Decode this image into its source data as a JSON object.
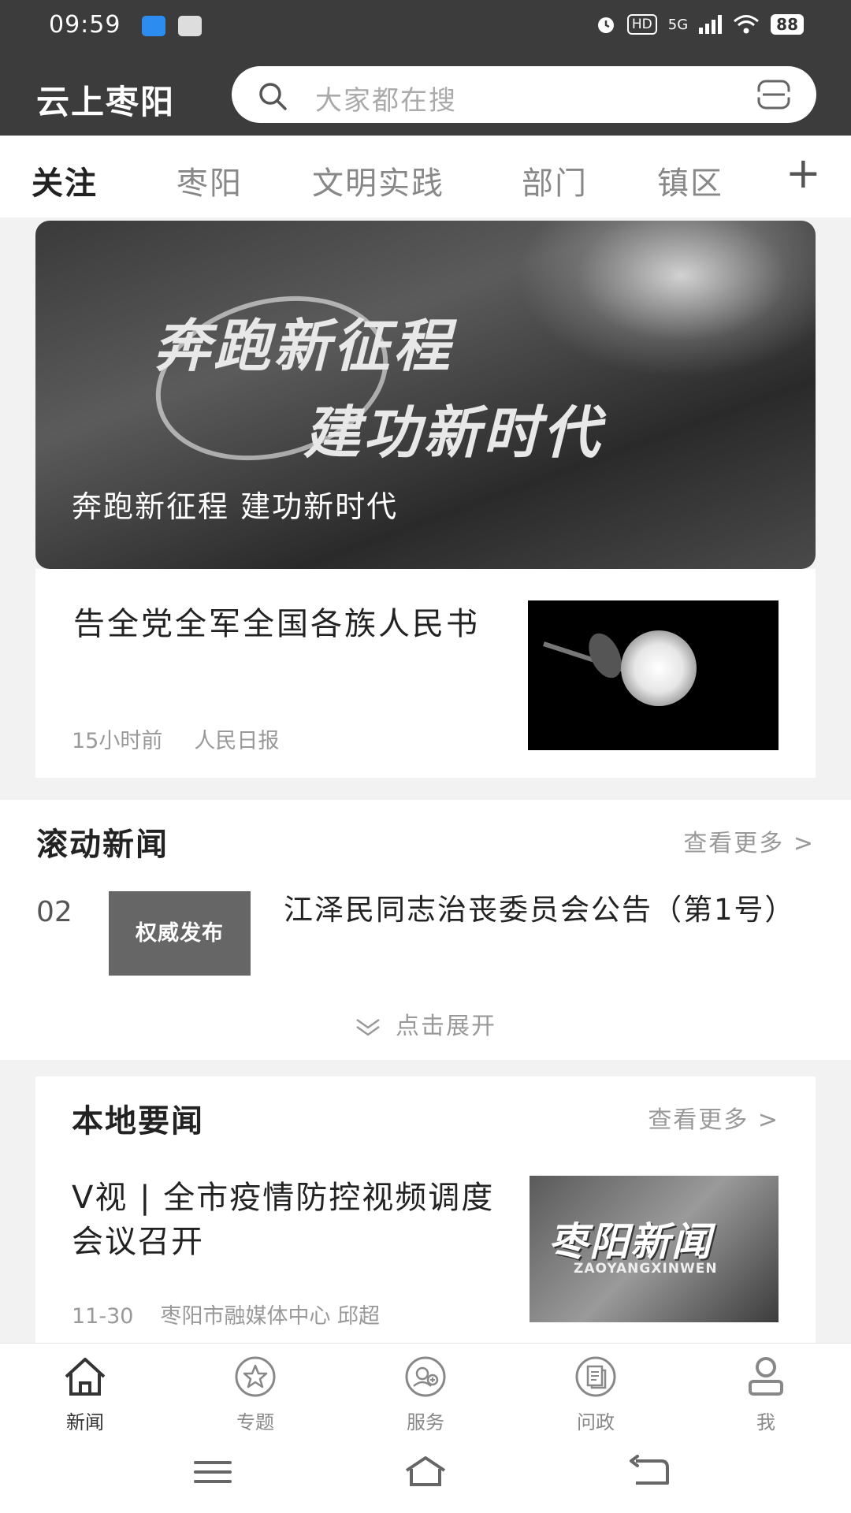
{
  "status_bar": {
    "time": "09:59",
    "hd": "HD",
    "network": "5G",
    "battery": "88"
  },
  "header": {
    "app_title": "云上枣阳",
    "search_placeholder": "大家都在搜"
  },
  "tabs": [
    "关注",
    "枣阳",
    "文明实践",
    "部门",
    "镇区"
  ],
  "tab_add": "+",
  "banner": {
    "art_line1": "奔跑新征程",
    "art_line2": "建功新时代",
    "caption": "奔跑新征程 建功新时代"
  },
  "feature_news": {
    "title": "告全党全军全国各族人民书",
    "time": "15小时前",
    "source": "人民日报"
  },
  "rolling_news": {
    "heading": "滚动新闻",
    "more": "查看更多 >",
    "item": {
      "index": "02",
      "tag": "权威发布",
      "title": "江泽民同志治丧委员会公告（第1号）"
    },
    "expand": "点击展开"
  },
  "local_news": {
    "heading": "本地要闻",
    "more": "查看更多 >",
    "title": "V视 | 全市疫情防控视频调度会议召开",
    "date": "11-30",
    "source": "枣阳市融媒体中心 邱超",
    "thumb_cn": "枣阳新闻",
    "thumb_en": "ZAOYANGXINWEN"
  },
  "bottom_nav": [
    {
      "label": "新闻",
      "icon": "home-icon"
    },
    {
      "label": "专题",
      "icon": "star-icon"
    },
    {
      "label": "服务",
      "icon": "service-icon"
    },
    {
      "label": "问政",
      "icon": "document-icon"
    },
    {
      "label": "我",
      "icon": "user-icon"
    }
  ]
}
